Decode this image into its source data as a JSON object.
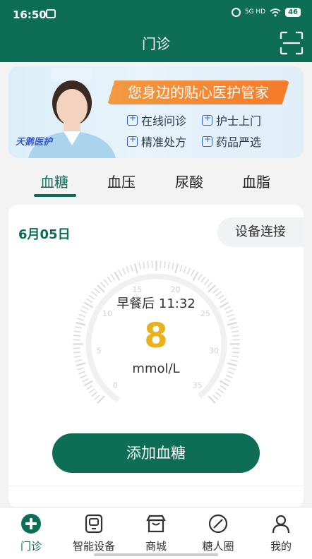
{
  "status_bar": {
    "time": "16:50",
    "network": "5G HD",
    "battery": "46"
  },
  "header": {
    "title": "门诊"
  },
  "banner": {
    "headline": "您身边的贴心医护管家",
    "logo": "天鹅医护",
    "features": [
      "在线问诊",
      "护士上门",
      "精准处方",
      "药品严选"
    ]
  },
  "tabs": [
    {
      "label": "血糖"
    },
    {
      "label": "血压"
    },
    {
      "label": "尿酸"
    },
    {
      "label": "血脂"
    }
  ],
  "card": {
    "date": "6月05日",
    "device_button": "设备连接",
    "gauge_ticks": [
      "0",
      "5",
      "10",
      "15",
      "20",
      "25",
      "30",
      "35"
    ],
    "reading": {
      "label": "早餐后 11:32",
      "value": "8",
      "unit": "mmol/L"
    },
    "add_button": "添加血糖"
  },
  "bottom_nav": [
    {
      "label": "门诊",
      "icon": "clinic-plus-icon"
    },
    {
      "label": "智能设备",
      "icon": "device-icon"
    },
    {
      "label": "商城",
      "icon": "store-icon"
    },
    {
      "label": "糖人圈",
      "icon": "circle-icon"
    },
    {
      "label": "我的",
      "icon": "profile-icon"
    }
  ],
  "colors": {
    "primary": "#0d6e55",
    "reading": "#e8b21c",
    "banner_orange": "#f47a2a"
  }
}
